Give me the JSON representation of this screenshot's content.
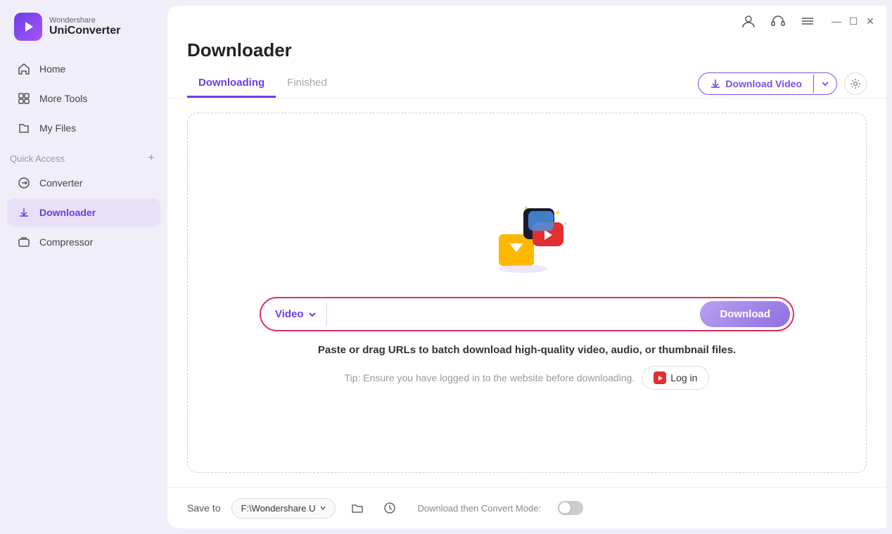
{
  "app": {
    "brand": "Wondershare",
    "name": "UniConverter"
  },
  "titlebar": {
    "icons": [
      "user",
      "headset",
      "list",
      "minimize",
      "maximize",
      "close"
    ]
  },
  "sidebar": {
    "items": [
      {
        "id": "home",
        "label": "Home",
        "active": false
      },
      {
        "id": "more-tools",
        "label": "More Tools",
        "active": false
      },
      {
        "id": "my-files",
        "label": "My Files",
        "active": false
      }
    ],
    "quick_access": {
      "label": "Quick Access",
      "items": [
        {
          "id": "converter",
          "label": "Converter",
          "active": false
        },
        {
          "id": "downloader",
          "label": "Downloader",
          "active": true
        },
        {
          "id": "compressor",
          "label": "Compressor",
          "active": false
        }
      ]
    }
  },
  "page": {
    "title": "Downloader",
    "tabs": [
      {
        "id": "downloading",
        "label": "Downloading",
        "active": true
      },
      {
        "id": "finished",
        "label": "Finished",
        "active": false
      }
    ],
    "download_video_button": "Download Video",
    "content": {
      "url_input": {
        "video_dropdown_label": "Video",
        "placeholder": "",
        "download_button": "Download"
      },
      "paste_hint": "Paste or drag URLs to batch download high-quality video, audio, or thumbnail files.",
      "tip_text": "Tip: Ensure you have logged in to the website before downloading.",
      "login_button": "Log in"
    },
    "footer": {
      "save_to_label": "Save to",
      "folder_path": "F:\\Wondershare U",
      "convert_mode_label": "Download then Convert Mode:"
    }
  }
}
